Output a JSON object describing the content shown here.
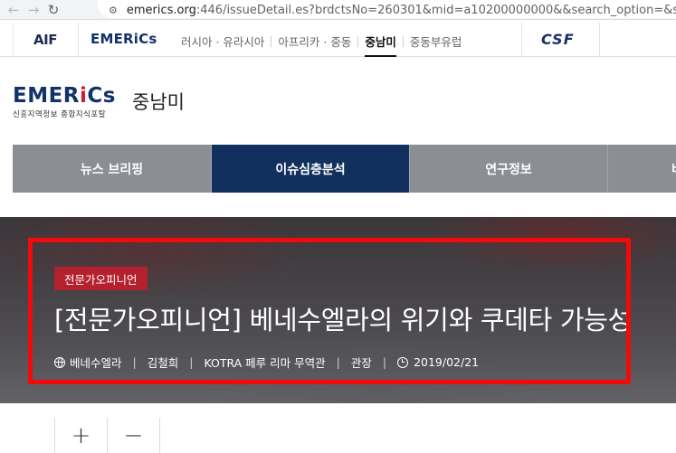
{
  "browser": {
    "url_host": "emerics.org",
    "url_rest": ":446/issueDetail.es?brdctsNo=260301&mid=a10200000000&&search_option=&sea",
    "back_icon": "arrow-left-icon",
    "forward_icon": "arrow-right-icon",
    "reload_icon": "reload-icon",
    "site_info_icon": "tune-icon"
  },
  "portal": {
    "aif_logo": "AIF",
    "emerics_logo": "EMERiCs",
    "menu": [
      {
        "label": "러시아 · 유라시아",
        "active": false
      },
      {
        "label": "아프리카 · 중동",
        "active": false
      },
      {
        "label": "중남미",
        "active": true
      },
      {
        "label": "중동부유럽",
        "active": false
      }
    ],
    "csf_logo": "CSF"
  },
  "header": {
    "logo_text_1": "EMER",
    "logo_text_i": "i",
    "logo_text_2": "Cs",
    "tagline": "신흥지역정보 종합지식포탈",
    "region_title": "중남미"
  },
  "mainnav": {
    "tabs": [
      {
        "label": "뉴스 브리핑",
        "active": false
      },
      {
        "label": "이슈심층분석",
        "active": true
      },
      {
        "label": "연구정보",
        "active": false
      },
      {
        "label": "비",
        "active": false
      }
    ]
  },
  "article": {
    "category": "전문가오피니언",
    "title": "[전문가오피니언] 베네수엘라의 위기와 쿠데타 가능성",
    "meta": {
      "country": "베네수엘라",
      "author": "김철희",
      "affiliation": "KOTRA 페루 리마 무역관",
      "position": "관장",
      "date": "2019/02/21"
    }
  },
  "font_controls": {
    "increase": "+",
    "decrease": "−"
  },
  "colors": {
    "highlight_border": "#f10a0a",
    "nav_active": "#11305e",
    "nav_inactive": "#8b8e95",
    "badge": "#b5202e",
    "brand": "#12326b"
  }
}
